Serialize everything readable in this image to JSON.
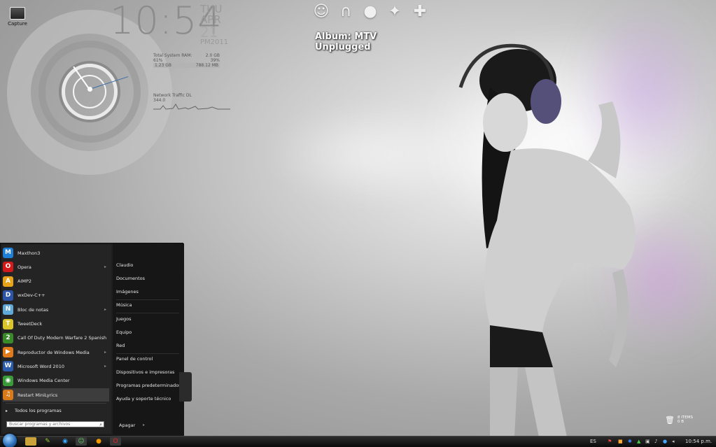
{
  "desktop": {
    "icon_label": "Capture",
    "album": "Album: MTV Unplugged",
    "recycle_bin": {
      "count": "8 ITEMS",
      "sub": "0 B"
    }
  },
  "clock": {
    "time": "10:54",
    "day": "THU",
    "month": "APR",
    "date": "21",
    "ampm": "PM",
    "year": "2011"
  },
  "system": {
    "ram_label": "Total System RAM:",
    "ram_total": "2.0 GB",
    "ram_pct": "61%",
    "ram_pct2": "39%",
    "ram_used": "1.23 GB",
    "ram_free": "788.12 MB",
    "net_label": "Network Traffic DL",
    "net_value": "344.0"
  },
  "launcher": [
    "users-icon",
    "headphones-icon",
    "disk-icon",
    "gamepad-icon",
    "apps-icon"
  ],
  "start_menu": {
    "programs": [
      {
        "label": "Maxthon3",
        "icon": "maxthon-icon",
        "color": "#1f7fd6",
        "glyph": "M",
        "arrow": false
      },
      {
        "label": "Opera",
        "icon": "opera-icon",
        "color": "#d21a1a",
        "glyph": "O",
        "arrow": true
      },
      {
        "label": "AIMP2",
        "icon": "aimp-icon",
        "color": "#e8a418",
        "glyph": "A",
        "arrow": false
      },
      {
        "label": "wxDev-C++",
        "icon": "devcpp-icon",
        "color": "#2c55a8",
        "glyph": "D",
        "arrow": false
      },
      {
        "label": "Bloc de notas",
        "icon": "notepad-icon",
        "color": "#5fa8d8",
        "glyph": "N",
        "arrow": true
      },
      {
        "label": "TweetDeck",
        "icon": "tweetdeck-icon",
        "color": "#d9c52a",
        "glyph": "T",
        "arrow": false
      },
      {
        "label": "Call Of Duty Modern Warfare 2 Spanish",
        "icon": "cod-icon",
        "color": "#3a8a2a",
        "glyph": "2",
        "arrow": false
      },
      {
        "label": "Reproductor de Windows Media",
        "icon": "wmp-icon",
        "color": "#e07a1a",
        "glyph": "▶",
        "arrow": true
      },
      {
        "label": "Microsoft Word 2010",
        "icon": "word-icon",
        "color": "#2a5caa",
        "glyph": "W",
        "arrow": true
      },
      {
        "label": "Windows Media Center",
        "icon": "wmc-icon",
        "color": "#3a9a3a",
        "glyph": "◉",
        "arrow": false
      },
      {
        "label": "Restart MiniLyrics",
        "icon": "minilyrics-icon",
        "color": "#d87a18",
        "glyph": "♫",
        "arrow": false
      }
    ],
    "all_programs": "Todos los programas",
    "search_placeholder": "Buscar programas y archivos",
    "links": [
      "Claudio",
      "Documentos",
      "Imágenes",
      "Música",
      "Juegos",
      "Equipo",
      "Red",
      "Panel de control",
      "Dispositivos e impresoras",
      "Programas predeterminados",
      "Ayuda y soporte técnico"
    ],
    "shutdown": "Apagar"
  },
  "taskbar": {
    "lang": "ES",
    "time": "10:54 p.m."
  }
}
